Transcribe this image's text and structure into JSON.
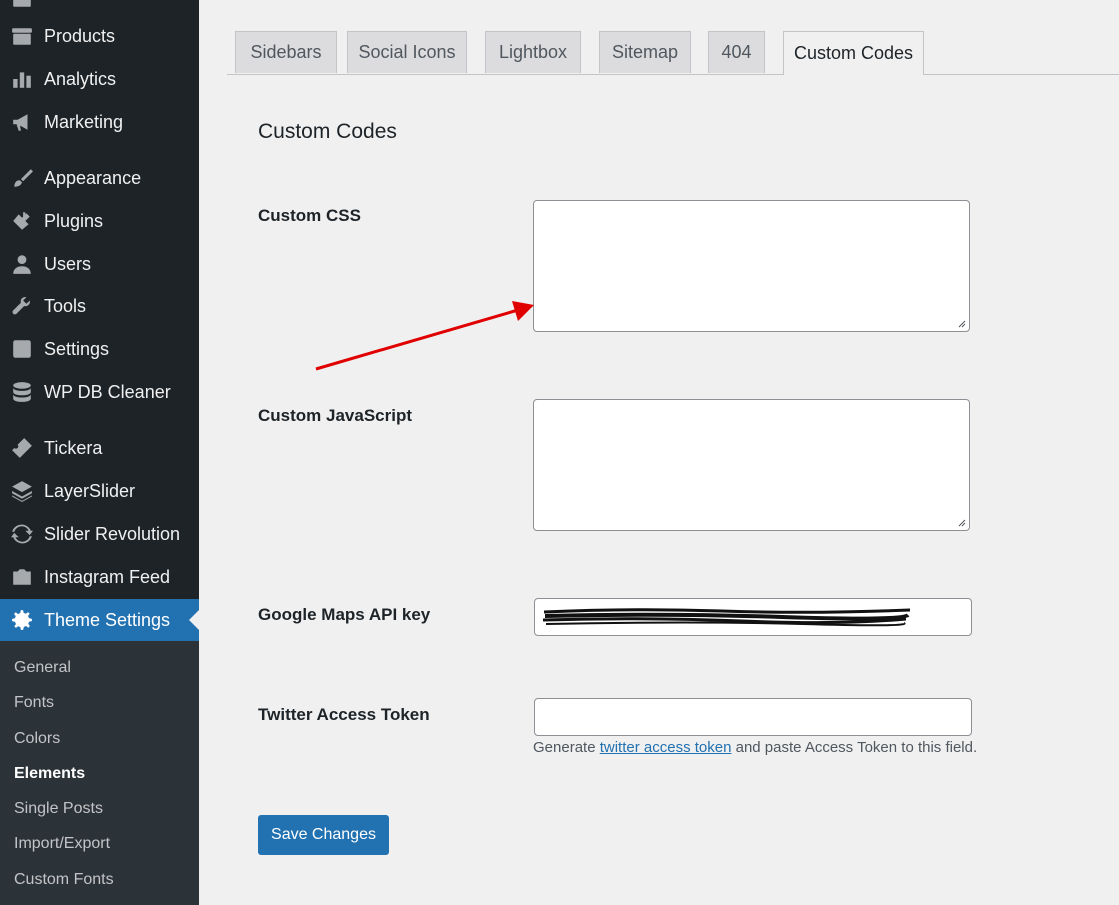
{
  "sidebar": {
    "items": [
      {
        "label": "Products",
        "icon": "archive-icon"
      },
      {
        "label": "Analytics",
        "icon": "bar-chart-icon"
      },
      {
        "label": "Marketing",
        "icon": "megaphone-icon"
      },
      {
        "label": "Appearance",
        "icon": "paintbrush-icon"
      },
      {
        "label": "Plugins",
        "icon": "plug-icon"
      },
      {
        "label": "Users",
        "icon": "user-icon"
      },
      {
        "label": "Tools",
        "icon": "wrench-icon"
      },
      {
        "label": "Settings",
        "icon": "sliders-icon"
      },
      {
        "label": "WP DB Cleaner",
        "icon": "database-icon"
      },
      {
        "label": "Tickera",
        "icon": "ticket-icon"
      },
      {
        "label": "LayerSlider",
        "icon": "layers-icon"
      },
      {
        "label": "Slider Revolution",
        "icon": "refresh-icon"
      },
      {
        "label": "Instagram Feed",
        "icon": "camera-icon"
      },
      {
        "label": "Theme Settings",
        "icon": "gear-icon"
      }
    ],
    "current": "Theme Settings",
    "submenu": [
      "General",
      "Fonts",
      "Colors",
      "Elements",
      "Single Posts",
      "Import/Export",
      "Custom Fonts"
    ],
    "submenu_active": "Elements"
  },
  "tabs": [
    "Sidebars",
    "Social Icons",
    "Lightbox",
    "Sitemap",
    "404",
    "Custom Codes"
  ],
  "active_tab": "Custom Codes",
  "section_title": "Custom Codes",
  "fields": {
    "custom_css": {
      "label": "Custom CSS",
      "value": ""
    },
    "custom_js": {
      "label": "Custom JavaScript",
      "value": ""
    },
    "google_maps": {
      "label": "Google Maps API key",
      "value": "",
      "redacted": true
    },
    "twitter": {
      "label": "Twitter Access Token",
      "value": "",
      "description_before": "Generate ",
      "description_link": "twitter access token",
      "description_after": " and paste Access Token to this field."
    }
  },
  "save_label": "Save Changes",
  "colors": {
    "sidebar_bg": "#1d2327",
    "submenu_bg": "#2c3338",
    "accent": "#2271b1",
    "annotation_arrow": "#e00000"
  }
}
